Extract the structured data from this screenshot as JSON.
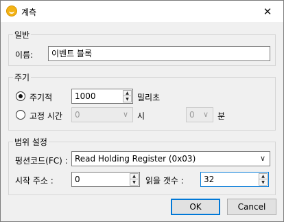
{
  "window": {
    "title": "계측",
    "close_glyph": "✕",
    "app_icon": "smiley-icon"
  },
  "general": {
    "legend": "일반",
    "name_label": "이름:",
    "name_value": "이벤트 블록"
  },
  "period": {
    "legend": "주기",
    "periodic_label": "주기적",
    "periodic_selected": true,
    "periodic_value": "1000",
    "periodic_unit": "밀리초",
    "fixed_label": "고정 시간",
    "fixed_selected": false,
    "hour_value": "0",
    "hour_unit": "시",
    "minute_value": "0",
    "minute_unit": "분"
  },
  "range": {
    "legend": "범위 설정",
    "function_label": "펑션코드(FC) :",
    "function_value": "Read Holding Register (0x03)",
    "start_label": "시작 주소 :",
    "start_value": "0",
    "count_label": "읽을 갯수 :",
    "count_value": "32"
  },
  "buttons": {
    "ok": "OK",
    "cancel": "Cancel"
  },
  "colors": {
    "accent": "#0078d7",
    "window_bg": "#f0f0f0"
  }
}
